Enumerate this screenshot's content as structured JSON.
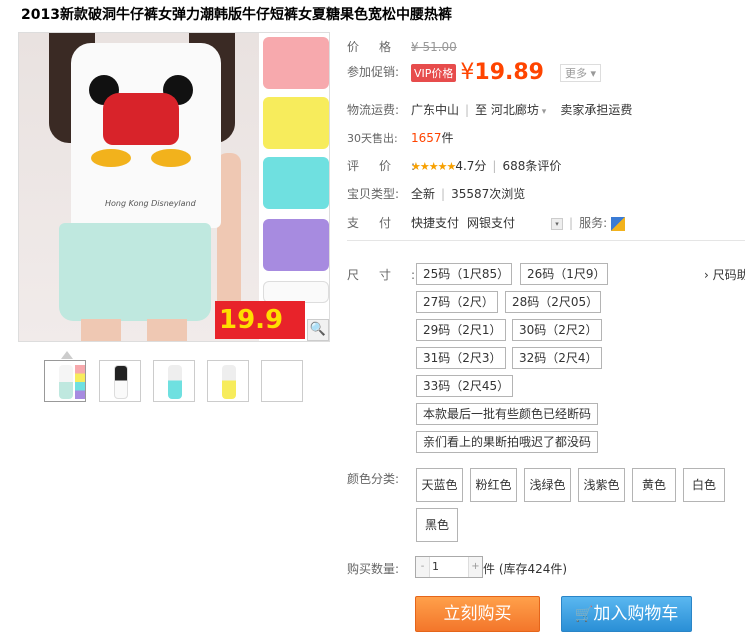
{
  "title": "2013新款破洞牛仔裤女弹力潮韩版牛仔短裤女夏糖果色宽松中腰热裤",
  "image": {
    "promo_text": "19.9包",
    "zoom_icon": "magnifier-icon",
    "shirt_text": "Hong Kong Disneyland"
  },
  "thumbnails": [
    {
      "label": "thumb-1"
    },
    {
      "label": "thumb-2"
    },
    {
      "label": "thumb-3"
    },
    {
      "label": "thumb-4"
    },
    {
      "label": "thumb-5"
    }
  ],
  "price": {
    "label": "价格:",
    "original": "¥ 51.00"
  },
  "promo": {
    "label": "参加促销:",
    "tag": "VIP价格",
    "yen": "¥",
    "price": "19.89",
    "more": "更多 ▾"
  },
  "shipping": {
    "label": "物流运费:",
    "from": "广东中山",
    "to_prefix": "至",
    "to": "河北廊坊",
    "fee": "卖家承担运费"
  },
  "sales": {
    "label": "30天售出:",
    "count": "1657",
    "unit": "件"
  },
  "rating": {
    "label": "评价:",
    "stars": "★★★★★",
    "score": "4.7分",
    "reviews": "688条评价"
  },
  "type": {
    "label": "宝贝类型:",
    "value": "全新",
    "views": "35587次浏览"
  },
  "payment": {
    "label": "支付:",
    "methods": [
      "快捷支付",
      "网银支付"
    ],
    "service_label": "服务:"
  },
  "size": {
    "label": "尺寸:",
    "chart_link": "› 尺码助",
    "options": [
      "25码（1尺85）",
      "26码（1尺9）",
      "27码（2尺）",
      "28码（2尺05）",
      "29码（2尺1）",
      "30码（2尺2）",
      "31码（2尺3）",
      "32码（2尺4）",
      "33码（2尺45）",
      "本款最后一批有些颜色已经断码",
      "亲们看上的果断拍哦迟了都没码"
    ]
  },
  "color": {
    "label": "颜色分类:",
    "options": [
      "天蓝色",
      "粉红色",
      "浅绿色",
      "浅紫色",
      "黄色",
      "白色",
      "黑色"
    ]
  },
  "quantity": {
    "label": "购买数量:",
    "value": "1",
    "minus": "-",
    "plus": "+",
    "stock": "件 (库存424件)"
  },
  "actions": {
    "buy": "立刻购买",
    "cart": "加入购物车"
  },
  "colors": {
    "price_red": "#ff4400",
    "buy_orange": "#f3762b",
    "cart_blue": "#2a8fd6"
  }
}
